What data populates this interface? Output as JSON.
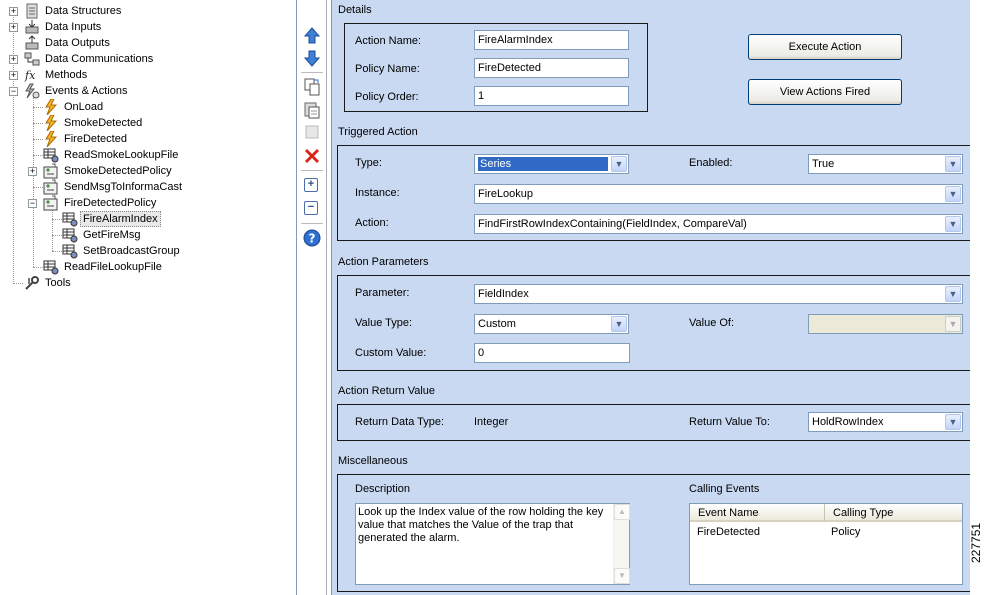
{
  "tree": {
    "items": [
      {
        "label": "Data Structures",
        "icon": "data-structures-icon",
        "expander": "+"
      },
      {
        "label": "Data Inputs",
        "icon": "data-inputs-icon",
        "expander": "+"
      },
      {
        "label": "Data Outputs",
        "icon": "data-outputs-icon",
        "expander": ""
      },
      {
        "label": "Data Communications",
        "icon": "data-communications-icon",
        "expander": "+"
      },
      {
        "label": "Methods",
        "icon": "methods-icon",
        "expander": "+"
      },
      {
        "label": "Events & Actions",
        "icon": "events-actions-icon",
        "expander": "−"
      },
      {
        "label": "OnLoad",
        "icon": "event-lightning-icon",
        "expander": ""
      },
      {
        "label": "SmokeDetected",
        "icon": "event-lightning-icon",
        "expander": ""
      },
      {
        "label": "FireDetected",
        "icon": "event-lightning-icon",
        "expander": ""
      },
      {
        "label": "ReadSmokeLookupFile",
        "icon": "action-grid-icon",
        "expander": ""
      },
      {
        "label": "SmokeDetectedPolicy",
        "icon": "policy-icon",
        "expander": "+"
      },
      {
        "label": "SendMsgToInformaCast",
        "icon": "policy-icon",
        "expander": ""
      },
      {
        "label": "FireDetectedPolicy",
        "icon": "policy-icon",
        "expander": "−"
      },
      {
        "label": "FireAlarmIndex",
        "icon": "action-grid-icon",
        "expander": ""
      },
      {
        "label": "GetFireMsg",
        "icon": "action-grid-icon",
        "expander": ""
      },
      {
        "label": "SetBroadcastGroup",
        "icon": "action-grid-icon",
        "expander": ""
      },
      {
        "label": "ReadFileLookupFile",
        "icon": "action-grid-icon",
        "expander": ""
      },
      {
        "label": "Tools",
        "icon": "tools-icon",
        "expander": ""
      }
    ],
    "selected": "FireAlarmIndex"
  },
  "toolbar": {
    "icons": [
      "move-up-icon",
      "move-down-icon",
      "copy-icon",
      "paste-icon",
      "cut-icon",
      "delete-icon",
      "zoom-in-icon",
      "zoom-out-icon",
      "help-icon"
    ]
  },
  "details": {
    "section": "Details",
    "action_name_label": "Action Name:",
    "action_name": "FireAlarmIndex",
    "policy_name_label": "Policy Name:",
    "policy_name": "FireDetected",
    "policy_order_label": "Policy Order:",
    "policy_order": "1",
    "execute_button": "Execute Action",
    "view_button": "View Actions Fired"
  },
  "triggered": {
    "section": "Triggered Action",
    "type_label": "Type:",
    "type": "Series",
    "enabled_label": "Enabled:",
    "enabled": "True",
    "instance_label": "Instance:",
    "instance": "FireLookup",
    "action_label": "Action:",
    "action": "FindFirstRowIndexContaining(FieldIndex, CompareVal)"
  },
  "params": {
    "section": "Action Parameters",
    "parameter_label": "Parameter:",
    "parameter": "FieldIndex",
    "value_type_label": "Value Type:",
    "value_type": "Custom",
    "value_of_label": "Value Of:",
    "value_of": "",
    "custom_value_label": "Custom Value:",
    "custom_value": "0"
  },
  "ret": {
    "section": "Action Return Value",
    "type_label": "Return Data Type:",
    "type": "Integer",
    "to_label": "Return Value To:",
    "to": "HoldRowIndex"
  },
  "misc": {
    "section": "Miscellaneous",
    "description_label": "Description",
    "description": "Look up the Index value of the row holding the key value that matches the Value of the trap that generated the alarm.",
    "calling_label": "Calling Events",
    "columns": [
      "Event Name",
      "Calling Type"
    ],
    "rows": [
      {
        "event": "FireDetected",
        "type": "Policy"
      }
    ]
  },
  "figure_id": "227751"
}
